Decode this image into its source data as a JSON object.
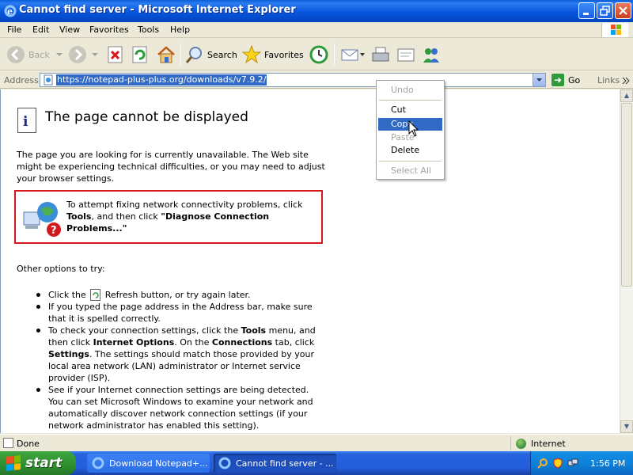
{
  "window": {
    "title": "Cannot find server - Microsoft Internet Explorer"
  },
  "menubar": {
    "items": [
      "File",
      "Edit",
      "View",
      "Favorites",
      "Tools",
      "Help"
    ]
  },
  "toolbar": {
    "back": "Back",
    "search": "Search",
    "favorites": "Favorites"
  },
  "address": {
    "label": "Address",
    "url": "https://notepad-plus-plus.org/downloads/v7.9.2/",
    "go": "Go",
    "links": "Links"
  },
  "page": {
    "heading": "The page cannot be displayed",
    "intro": "The page you are looking for is currently unavailable. The Web site might be experiencing technical difficulties, or you may need to adjust your browser settings.",
    "callout": {
      "t1": "To attempt fixing network connectivity problems, click ",
      "b1": "Tools",
      "t2": ", and then click ",
      "b2": "\"Diagnose Connection Problems...\""
    },
    "other": "Other options to try:",
    "b1": {
      "t1": "Click the ",
      "t2": " Refresh button, or try again later."
    },
    "b2": "If you typed the page address in the Address bar, make sure that it is spelled correctly.",
    "b3": {
      "t1": "To check your connection settings, click the ",
      "k1": "Tools",
      "t2": " menu, and then click ",
      "k2": "Internet Options",
      "t3": ". On the ",
      "k3": "Connections",
      "t4": " tab, click ",
      "k4": "Settings",
      "t5": ". The settings should match those provided by your local area network (LAN) administrator or Internet service provider (ISP)."
    },
    "b4": "See if your Internet connection settings are being detected. You can set Microsoft Windows to examine your network and automatically discover network connection settings (if your network administrator has enabled this setting)."
  },
  "context_menu": {
    "undo": "Undo",
    "cut": "Cut",
    "copy": "Copy",
    "paste": "Paste",
    "delete": "Delete",
    "select_all": "Select All"
  },
  "status": {
    "text": "Done",
    "zone": "Internet"
  },
  "taskbar": {
    "start": "start",
    "task1": "Download Notepad+...",
    "task2": "Cannot find server - ...",
    "clock": "1:56 PM"
  },
  "colors": {
    "title_blue": "#0855dd",
    "selection": "#316ac5",
    "callout_border": "#d4181c",
    "start_green": "#2f8e2f"
  }
}
